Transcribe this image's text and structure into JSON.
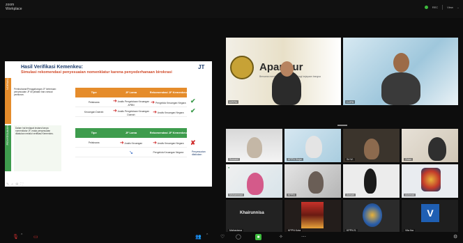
{
  "app": {
    "brand": "zoom",
    "title": "Workplace"
  },
  "top_bar": {
    "status_text": "REC",
    "view_label": "View"
  },
  "slide": {
    "title": "Hasil Verifikasi Kemenkeu:",
    "subtitle": "Simulasi rekomendasi penyesuaian nomenklatur karena penyederhanaan birokrasi",
    "band_top_label": "NORMAL",
    "band_bottom_label": "PENYESUAIAN",
    "left_text_top": "Pembubaran/Penggabungan JF ketentuan: penyesuaian JF ke jabatan baru sesuai peraturan.",
    "left_text_bottom": "Dalam hal terdapat instansi tanpa nomenklatur JF, maka penyesuaian dilakukan melalui verifikasi Kemenkeu.",
    "top_table": {
      "headers": [
        "Tipe",
        "JF Lama",
        "Rekomendasi JF Kemenkeu"
      ],
      "rows": [
        [
          "Pelaksana",
          "Analis Pengelolaan Keuangan APBN",
          "Pengelola Keuangan Negara"
        ],
        [
          "Keuangan Daerah",
          "Analis Pengelolaan Keuangan Daerah",
          "Analis Keuangan Negara"
        ]
      ]
    },
    "bottom_table": {
      "headers": [
        "Tipe",
        "JF Lama",
        "Rekomendasi JF Kemenkeu"
      ],
      "rows": [
        [
          "Pelaksana",
          "Analis Keuangan",
          "Analis Keuangan Negara"
        ],
        [
          "",
          "",
          "Pengelola Keuangan Negara"
        ]
      ]
    },
    "note": "Penyesuaian dilakukan"
  },
  "main_tiles": [
    {
      "name": "KPPN",
      "banner": "Aparatur",
      "banner_sub": "Bersama meningkatkan kompetensi bagi kejayaan bangsa"
    },
    {
      "name": "DJPB"
    }
  ],
  "grid_tiles": [
    {
      "name": "Suwarni"
    },
    {
      "name": "KPPN Sinjai"
    },
    {
      "name": "Sri W."
    },
    {
      "name": "Zidan"
    },
    {
      "name": "Muhammad"
    },
    {
      "name": "KPPN"
    },
    {
      "name": "Anisah"
    },
    {
      "name": "Achmad"
    },
    {
      "name": "Mahasiswa",
      "text": "Khairunnisa"
    },
    {
      "name": "KPPN Kota"
    },
    {
      "name": "KPPN S."
    },
    {
      "name": "Vita Ika",
      "avatar_letter": "V"
    }
  ],
  "icons": {
    "mic": "mic-icon",
    "video": "video-icon",
    "participants": "participants-icon",
    "share": "share-icon",
    "record": "record-icon",
    "more": "more-icon"
  }
}
